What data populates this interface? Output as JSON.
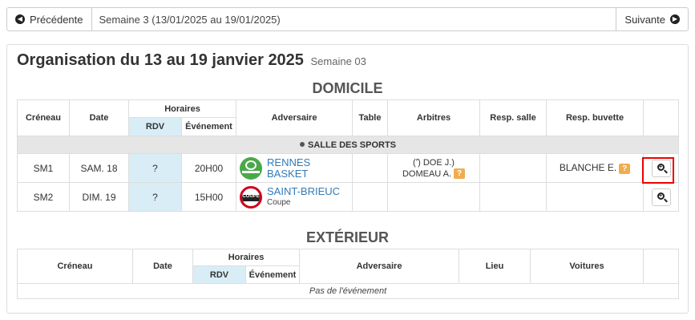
{
  "nav": {
    "prev_label": "Précédente",
    "next_label": "Suivante",
    "week_label": "Semaine 3 (13/01/2025 au 19/01/2025)"
  },
  "page": {
    "title": "Organisation du 13 au 19 janvier 2025",
    "subtitle": "Semaine 03"
  },
  "home": {
    "title": "DOMICILE",
    "headers": {
      "creneau": "Créneau",
      "date": "Date",
      "horaires": "Horaires",
      "rdv": "RDV",
      "evenement": "Événement",
      "adversaire": "Adversaire",
      "table": "Table",
      "arbitres": "Arbitres",
      "resp_salle": "Resp. salle",
      "resp_buvette": "Resp. buvette"
    },
    "venue": "SALLE DES SPORTS",
    "rows": [
      {
        "creneau": "SM1",
        "date": "SAM. 18",
        "rdv": "?",
        "evenement": "20H00",
        "adversaire": "RENNES BASKET",
        "adversaire_sub": "",
        "arbitre_1": "(ʻ̑) DOE J.)",
        "arbitre_2": "DOMEAU A.",
        "arbitre_badge": "?",
        "resp_buvette": "BLANCHE E.",
        "buvette_badge": "?"
      },
      {
        "creneau": "SM2",
        "date": "DIM. 19",
        "rdv": "?",
        "evenement": "15H00",
        "adversaire": "SAINT-BRIEUC",
        "adversaire_sub": "Coupe",
        "logo_text": "COUPE"
      }
    ]
  },
  "away": {
    "title": "EXTÉRIEUR",
    "headers": {
      "creneau": "Créneau",
      "date": "Date",
      "horaires": "Horaires",
      "rdv": "RDV",
      "evenement": "Événement",
      "adversaire": "Adversaire",
      "lieu": "Lieu",
      "voitures": "Voitures"
    },
    "empty": "Pas de l'événement"
  }
}
